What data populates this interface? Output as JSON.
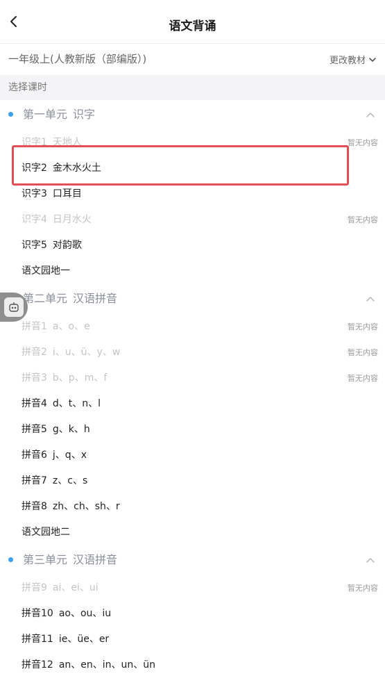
{
  "header": {
    "title": "语文背诵"
  },
  "book": {
    "name": "一年级上(人教新版（部编版）)",
    "change_label": "更改教材"
  },
  "section_label": "选择课时",
  "units": [
    {
      "label": "第一单元",
      "name": "识字",
      "lessons": [
        {
          "num": "识字1",
          "title": "天地人",
          "status": "暂无内容",
          "enabled": false
        },
        {
          "num": "识字2",
          "title": "金木水火土",
          "status": "",
          "enabled": true
        },
        {
          "num": "识字3",
          "title": "口耳目",
          "status": "",
          "enabled": true
        },
        {
          "num": "识字4",
          "title": "日月水火",
          "status": "暂无内容",
          "enabled": false
        },
        {
          "num": "识字5",
          "title": "对韵歌",
          "status": "",
          "enabled": true
        },
        {
          "num": "语文园地一",
          "title": "",
          "status": "",
          "enabled": true
        }
      ]
    },
    {
      "label": "第二单元",
      "name": "汉语拼音",
      "lessons": [
        {
          "num": "拼音1",
          "title": "a、o、e",
          "status": "暂无内容",
          "enabled": false
        },
        {
          "num": "拼音2",
          "title": "i、u、ü、y、w",
          "status": "暂无内容",
          "enabled": false
        },
        {
          "num": "拼音3",
          "title": "b、p、m、f",
          "status": "暂无内容",
          "enabled": false
        },
        {
          "num": "拼音4",
          "title": "d、t、n、l",
          "status": "",
          "enabled": true
        },
        {
          "num": "拼音5",
          "title": "g、k、h",
          "status": "",
          "enabled": true
        },
        {
          "num": "拼音6",
          "title": "j、q、x",
          "status": "",
          "enabled": true
        },
        {
          "num": "拼音7",
          "title": "z、c、s",
          "status": "",
          "enabled": true
        },
        {
          "num": "拼音8",
          "title": "zh、ch、sh、r",
          "status": "",
          "enabled": true
        },
        {
          "num": "语文园地二",
          "title": "",
          "status": "",
          "enabled": true
        }
      ]
    },
    {
      "label": "第三单元",
      "name": "汉语拼音",
      "lessons": [
        {
          "num": "拼音9",
          "title": "ai、ei、ui",
          "status": "暂无内容",
          "enabled": false
        },
        {
          "num": "拼音10",
          "title": "ao、ou、iu",
          "status": "",
          "enabled": true
        },
        {
          "num": "拼音11",
          "title": "ie、üe、er",
          "status": "",
          "enabled": true
        },
        {
          "num": "拼音12",
          "title": "an、en、in、un、ün",
          "status": "",
          "enabled": true
        }
      ]
    }
  ],
  "colors": {
    "accent_dot": "#3aa1f2",
    "highlight_border": "#e04f54",
    "disabled_text": "#c4c4c4"
  },
  "icons": {
    "back": "chevron-left-icon",
    "change_book": "chevron-down-icon",
    "unit_toggle": "chevron-up-icon",
    "assistant": "robot-assistant-icon"
  }
}
